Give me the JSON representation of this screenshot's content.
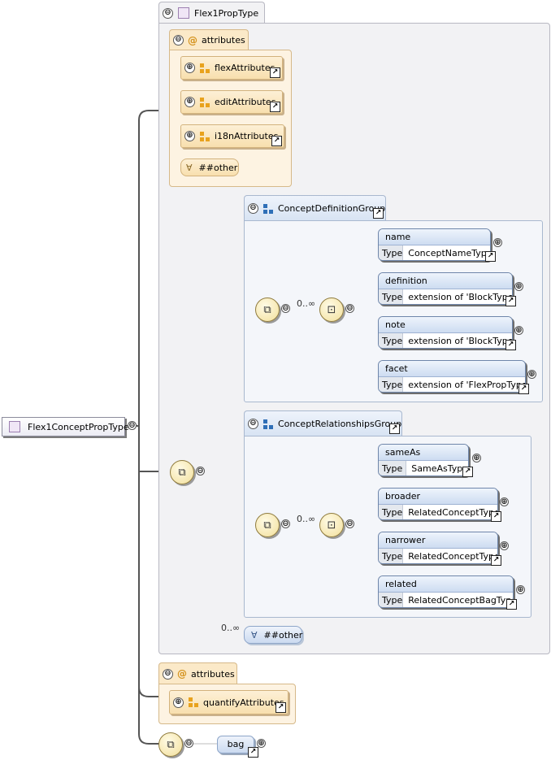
{
  "root": {
    "label": "Flex1ConceptPropType"
  },
  "complex_type": {
    "label": "Flex1PropType"
  },
  "attributes_top": {
    "label": "attributes",
    "items": [
      {
        "label": "flexAttributes"
      },
      {
        "label": "editAttributes"
      },
      {
        "label": "i18nAttributes"
      }
    ],
    "any_label": "##other"
  },
  "concept_definition_group": {
    "label": "ConceptDefinitionGroup",
    "multiplicity": "0..∞",
    "elements": [
      {
        "name": "name",
        "type_key": "Type",
        "type": "ConceptNameType"
      },
      {
        "name": "definition",
        "type_key": "Type",
        "type": "extension of 'BlockType'"
      },
      {
        "name": "note",
        "type_key": "Type",
        "type": "extension of 'BlockType'"
      },
      {
        "name": "facet",
        "type_key": "Type",
        "type": "extension of 'FlexPropType'"
      }
    ]
  },
  "concept_relationships_group": {
    "label": "ConceptRelationshipsGroup",
    "multiplicity": "0..∞",
    "elements": [
      {
        "name": "sameAs",
        "type_key": "Type",
        "type": "SameAsType"
      },
      {
        "name": "broader",
        "type_key": "Type",
        "type": "RelatedConceptType"
      },
      {
        "name": "narrower",
        "type_key": "Type",
        "type": "RelatedConceptType"
      },
      {
        "name": "related",
        "type_key": "Type",
        "type": "RelatedConceptBagType"
      }
    ]
  },
  "any_other": {
    "multiplicity": "0..∞",
    "label": "##other"
  },
  "attributes_bottom": {
    "label": "attributes",
    "items": [
      {
        "label": "quantifyAttributes"
      }
    ]
  },
  "bag": {
    "label": "bag"
  },
  "icons": {
    "collapse": "⊖",
    "expand": "⊕",
    "link": "↗",
    "sequence": "sequence-compositor-icon",
    "any": "∀"
  },
  "colors": {
    "wire": "#555555",
    "attr_fill": "#f8dfae",
    "group_fill": "#cddcf1",
    "root_border": "#8c8c9c"
  }
}
